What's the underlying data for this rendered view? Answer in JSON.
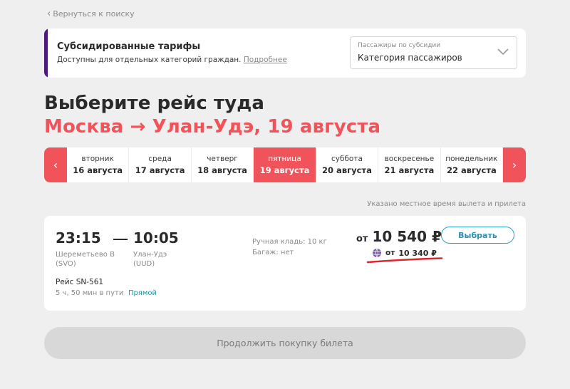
{
  "back_link": {
    "label": "Вернуться к поиску"
  },
  "subsidy": {
    "title": "Субсидированные тарифы",
    "subtitle": "Доступны для отдельных категорий граждан.",
    "more_link": "Подробнее",
    "select_label": "Пассажиры по субсидии",
    "select_value": "Категория пассажиров"
  },
  "heading": {
    "title": "Выберите рейс туда",
    "route": "Москва → Улан-Удэ, 19 августа"
  },
  "dates": [
    {
      "dow": "вторник",
      "date": "16 августа"
    },
    {
      "dow": "среда",
      "date": "17 августа"
    },
    {
      "dow": "четверг",
      "date": "18 августа"
    },
    {
      "dow": "пятница",
      "date": "19 августа"
    },
    {
      "dow": "суббота",
      "date": "20 августа"
    },
    {
      "dow": "воскресенье",
      "date": "21 августа"
    },
    {
      "dow": "понедельник",
      "date": "22 августа"
    }
  ],
  "local_time_note": "Указано местное время вылета и прилета",
  "flight": {
    "dep_time": "23:15",
    "arr_time": "10:05",
    "dep_airport": "Шереметьево B",
    "dep_code": "(SVO)",
    "arr_airport": "Улан-Удэ",
    "arr_code": "(UUD)",
    "hand_luggage": "Ручная кладь: 10 кг",
    "baggage": "Багаж: нет",
    "price_prefix": "от",
    "price": "10 540 ₽",
    "sub_price_prefix": "от",
    "sub_price": "10 340 ₽",
    "choose_label": "Выбрать",
    "flight_number": "Рейс SN-561",
    "duration": "5 ч, 50 мин в пути",
    "direct": "Прямой"
  },
  "continue_label": "Продолжить покупку билета",
  "colors": {
    "accent_red": "#f0545a",
    "accent_purple": "#4b1a7a",
    "link_teal": "#1a9aa8"
  }
}
